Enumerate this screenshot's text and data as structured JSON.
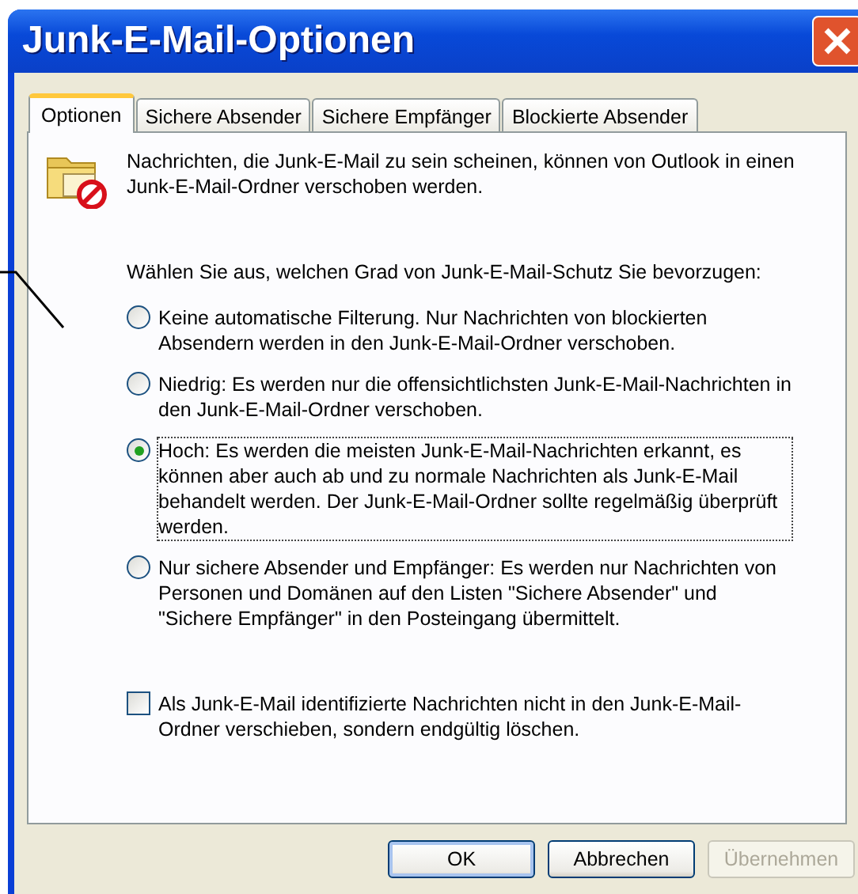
{
  "window": {
    "title": "Junk-E-Mail-Optionen"
  },
  "tabs": [
    {
      "label": "Optionen",
      "selected": true
    },
    {
      "label": "Sichere Absender",
      "selected": false
    },
    {
      "label": "Sichere Empfänger",
      "selected": false
    },
    {
      "label": "Blockierte Absender",
      "selected": false
    }
  ],
  "intro": "Nachrichten, die Junk-E-Mail zu sein scheinen, können von Outlook in einen Junk-E-Mail-Ordner verschoben werden.",
  "prompt": "Wählen Sie aus, welchen Grad von Junk-E-Mail-Schutz Sie bevorzugen:",
  "levels": [
    {
      "label": "Keine automatische Filterung. Nur Nachrichten von blockierten Absendern werden in den Junk-E-Mail-Ordner verschoben.",
      "selected": false
    },
    {
      "label": "Niedrig: Es werden nur die offensichtlichsten Junk-E-Mail-Nachrichten in den Junk-E-Mail-Ordner verschoben.",
      "selected": false
    },
    {
      "label": "Hoch: Es werden die meisten Junk-E-Mail-Nachrichten erkannt, es können aber auch ab und zu normale Nachrichten als Junk-E-Mail behandelt werden. Der Junk-E-Mail-Ordner sollte regelmäßig überprüft werden.",
      "selected": true
    },
    {
      "label": "Nur sichere Absender und Empfänger: Es werden nur Nachrichten von Personen und Domänen auf den Listen \"Sichere Absender\" und \"Sichere Empfänger\" in den Posteingang übermittelt.",
      "selected": false
    }
  ],
  "delete_option": {
    "label": "Als Junk-E-Mail identifizierte Nachrichten nicht in den Junk-E-Mail-Ordner verschieben, sondern endgültig löschen.",
    "checked": false
  },
  "buttons": [
    {
      "label": "OK",
      "disabled": false,
      "default": true
    },
    {
      "label": "Abbrechen",
      "disabled": false,
      "default": false
    },
    {
      "label": "Übernehmen",
      "disabled": true,
      "default": false
    }
  ]
}
